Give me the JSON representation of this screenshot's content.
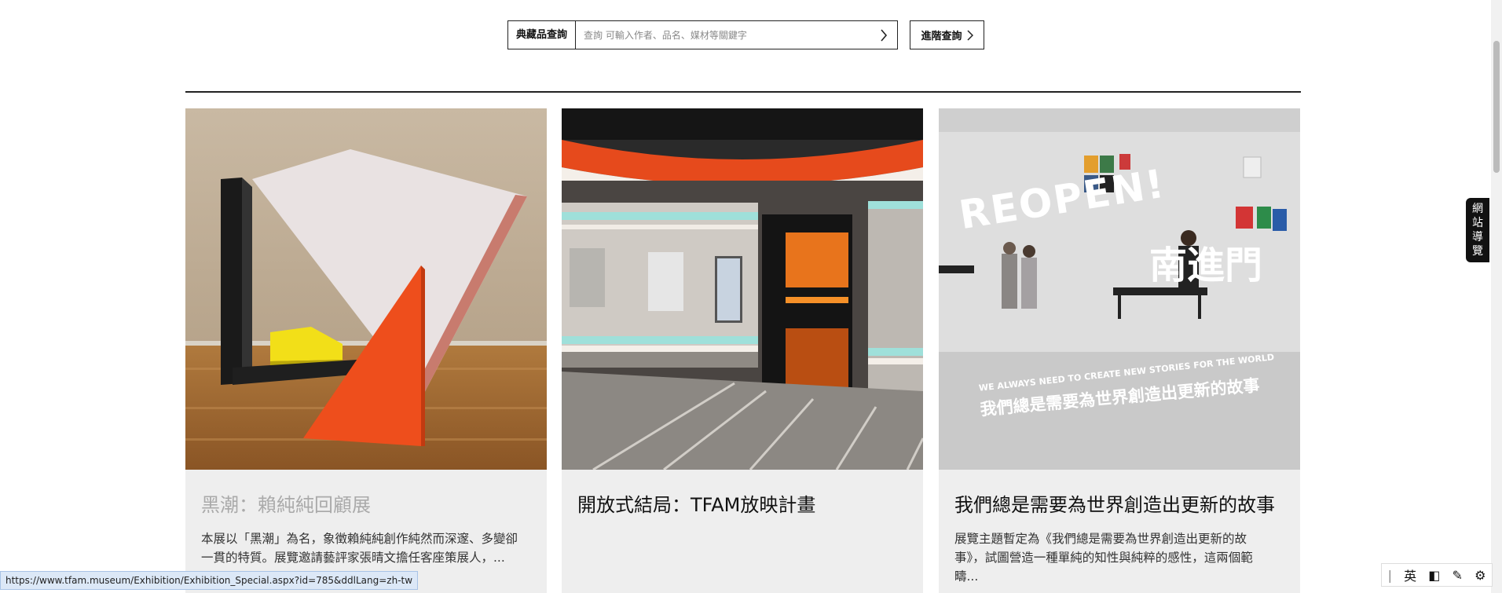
{
  "search": {
    "label": "典藏品查詢",
    "placeholder": "查詢 可輸入作者、品名、媒材等關鍵字",
    "advanced_label": "進階查詢"
  },
  "cards": [
    {
      "title": "黑潮：賴純純回顧展",
      "desc": "本展以「黑潮」為名，象徵賴純純創作純然而深邃、多變卻一貫的特質。展覽邀請藝評家張晴文擔任客座策展人，..."
    },
    {
      "title": "開放式結局：TFAM放映計畫",
      "desc": ""
    },
    {
      "title": "我們總是需要為世界創造出更新的故事",
      "desc": "展覽主題暫定為《我們總是需要為世界創造出更新的故事》，試圖營造一種單純的知性與純粹的感性，這兩個範疇...",
      "image_text": {
        "reopen": "REOPEN!",
        "gate": "南進門",
        "arc_en": "WE ALWAYS NEED TO CREATE NEW STORIES FOR THE WORLD",
        "arc_zh": "我們總是需要為世界創造出更新的故事"
      }
    }
  ],
  "side_tab": [
    "網",
    "站",
    "導",
    "覽"
  ],
  "status_url": "https://www.tfam.museum/Exhibition/Exhibition_Special.aspx?id=785&ddlLang=zh-tw",
  "ime": {
    "lang": "英"
  },
  "colors": {
    "card_bg": "#eeeeee",
    "accent_orange": "#e8481c",
    "text": "#111111"
  }
}
